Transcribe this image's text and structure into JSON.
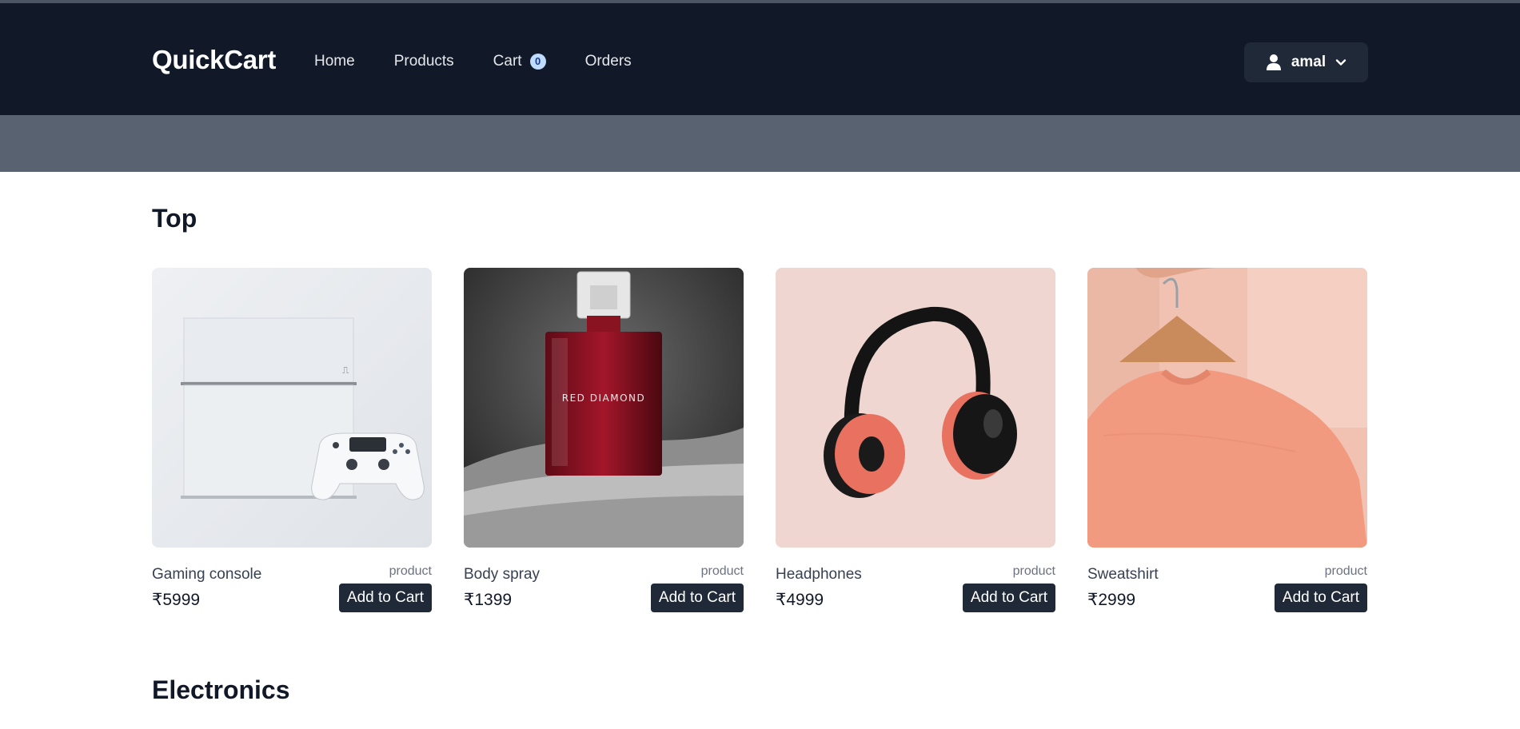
{
  "brand": {
    "name": "QuickCart"
  },
  "nav": [
    {
      "label": "Home"
    },
    {
      "label": "Products"
    },
    {
      "label": "Cart",
      "badge": "0"
    },
    {
      "label": "Orders"
    }
  ],
  "user": {
    "name": "amal",
    "icon": "user-icon",
    "dropdown_icon": "chevron-down-icon"
  },
  "sections": [
    {
      "title": "Top",
      "products": [
        {
          "name": "Gaming console",
          "category": "product",
          "price": "₹5999",
          "button": "Add to Cart",
          "image": "game-console-image"
        },
        {
          "name": "Body spray",
          "category": "product",
          "price": "₹1399",
          "button": "Add to Cart",
          "image": "perfume-bottle-image"
        },
        {
          "name": "Headphones",
          "category": "product",
          "price": "₹4999",
          "button": "Add to Cart",
          "image": "headphones-image"
        },
        {
          "name": "Sweatshirt",
          "category": "product",
          "price": "₹2999",
          "button": "Add to Cart",
          "image": "sweatshirt-image"
        }
      ]
    },
    {
      "title": "Electronics",
      "products": []
    }
  ],
  "images": {
    "perfume_label": "RED DIAMOND"
  },
  "colors": {
    "header": "#111827",
    "hero": "#586271",
    "button": "#1f2937",
    "badge": "#bfdbfe"
  }
}
